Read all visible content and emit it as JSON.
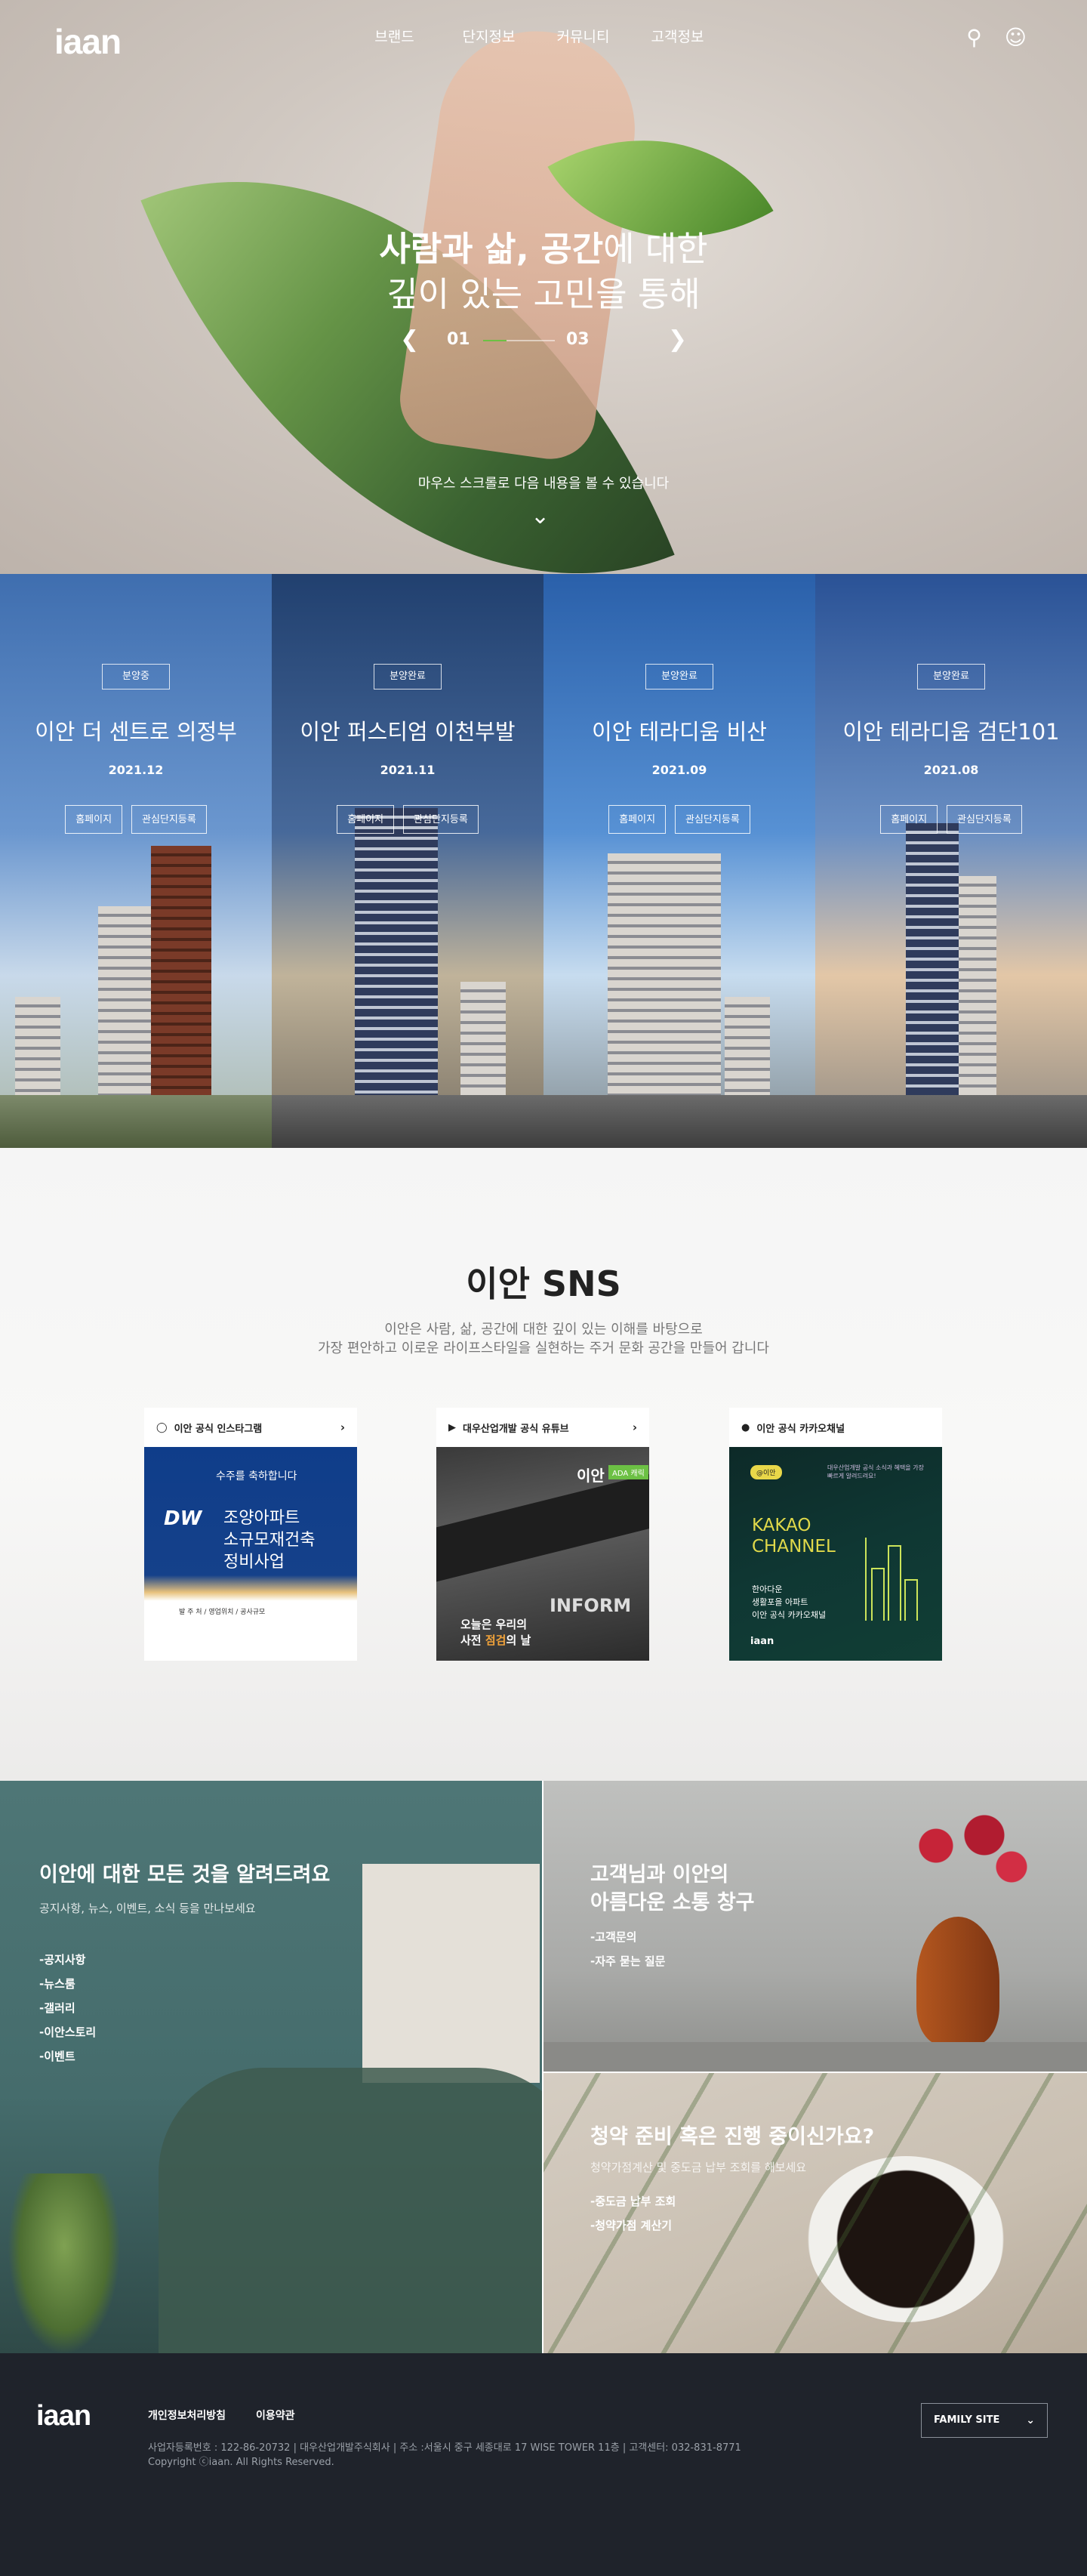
{
  "header": {
    "logo": "iaan",
    "nav": [
      "브랜드",
      "단지정보",
      "커뮤니티",
      "고객정보"
    ],
    "icons": [
      "search-icon",
      "user-icon"
    ]
  },
  "hero": {
    "line1_bold": "사람과 삶, 공간",
    "line1_rest": "에 대한",
    "line2": "깊이 있는 고민을 통해",
    "slide_current": "01",
    "slide_total": "03",
    "slide_progress": 0.33,
    "scroll_hint": "마우스 스크롤로 다음 내용을 볼 수 있습니다"
  },
  "complexes": [
    {
      "status": "분양중",
      "name": "이안 더 센트로 의정부",
      "date": "2021.12",
      "btn_home": "홈페이지",
      "btn_register": "관심단지등록"
    },
    {
      "status": "분양완료",
      "name": "이안 퍼스티엄 이천부발",
      "date": "2021.11",
      "btn_home": "홈페이지",
      "btn_register": "관심단지등록"
    },
    {
      "status": "분양완료",
      "name": "이안 테라디움 비산",
      "date": "2021.09",
      "btn_home": "홈페이지",
      "btn_register": "관심단지등록"
    },
    {
      "status": "분양완료",
      "name": "이안 테라디움 검단101",
      "date": "2021.08",
      "btn_home": "홈페이지",
      "btn_register": "관심단지등록"
    }
  ],
  "sns": {
    "title": "이안 SNS",
    "desc_line1": "이안은 사람, 삶, 공간에 대한 깊이 있는 이해를 바탕으로",
    "desc_line2": "가장 편안하고 이로운 라이프스타일을 실현하는 주거 문화 공간을 만들어 갑니다",
    "cards": [
      {
        "title": "이안 공식 인스타그램",
        "icon": "instagram-icon",
        "img_text1": "수주를 축하합니다",
        "img_text2": "조양아파트",
        "img_text3": "소규모재건축",
        "img_text4": "정비사업",
        "img_brand": "DW",
        "img_foot": "발 주 처 / 영업위치 / 공사규모"
      },
      {
        "title": "대우산업개발 공식 유튜브",
        "icon": "youtube-icon",
        "img_brand": "이안",
        "img_tag": "ADA 캐릭",
        "img_sign": "INFORM",
        "img_cap1": "오늘은 우리의",
        "img_cap2_a": "사전 ",
        "img_cap2_b": "점검",
        "img_cap2_c": "의 날"
      },
      {
        "title": "이안 공식 카카오채널",
        "icon": "kakao-icon",
        "img_pill": "@이안",
        "img_note": "대우산업개발 공식 소식과 혜택을 가장 빠르게 알려드려요!",
        "img_kakao1": "KAKAO",
        "img_kakao2": "CHANNEL",
        "img_label1": "한아다운",
        "img_label2": "생활포을 아파트",
        "img_label3": "이안 공식 카카오채널",
        "img_logo": "iaan"
      }
    ]
  },
  "info": {
    "news": {
      "title": "이안에 대한 모든 것을 알려드려요",
      "sub": "공지사항, 뉴스, 이벤트, 소식 등을 만나보세요",
      "links": [
        "-공지사항",
        "-뉴스룸",
        "-갤러리",
        "-이안스토리",
        "-이벤트"
      ]
    },
    "support": {
      "title1": "고객님과 이안의",
      "title2": "아름다운 소통 창구",
      "links": [
        "-고객문의",
        "-자주 묻는 질문"
      ]
    },
    "subscription": {
      "title": "청약 준비 혹은 진행 중이신가요?",
      "sub": "청약가점계산 및 중도금 납부 조회를 해보세요",
      "links": [
        "-중도금 납부 조회",
        "-청약가점 계산기"
      ]
    }
  },
  "footer": {
    "logo": "iaan",
    "links": [
      "개인정보처리방침",
      "이용약관"
    ],
    "addr_line1": "사업자등록번호 : 122-86-20732  |  대우산업개발주식회사  |  주소 :서울시 중구 세종대로 17 WISE TOWER 11층  |  고객센터: 032-831-8771",
    "addr_line2": "Copyright ⓒiaan. All Rights Reserved.",
    "family_site": "FAMILY SITE"
  }
}
